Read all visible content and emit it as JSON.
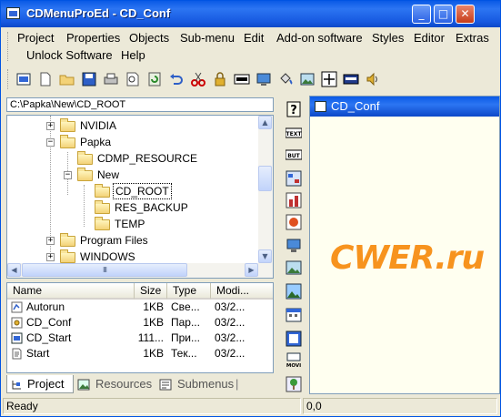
{
  "window": {
    "title": "CDMenuProEd - CD_Conf"
  },
  "caption_buttons": {
    "minimize": "_",
    "maximize": "□",
    "close": "✕"
  },
  "menu": {
    "items": [
      "Project",
      "Properties",
      "Objects",
      "Sub-menu",
      "Edit",
      "Add-on software",
      "Styles",
      "Editor",
      "Extras",
      "Unlock Software",
      "Help"
    ]
  },
  "toolbar": {
    "icons": [
      "new-project-icon",
      "new-file-icon",
      "open-folder-icon",
      "save-icon",
      "print-icon",
      "print-preview-icon",
      "refresh-icon",
      "undo-icon",
      "cut-icon",
      "lock-icon",
      "start-button-icon",
      "monitor-icon",
      "paint-bucket-icon",
      "picture-icon",
      "move-arrows-icon",
      "title-icon",
      "speaker-icon"
    ]
  },
  "path": {
    "value": "C:\\Papka\\New\\CD_ROOT"
  },
  "tree": {
    "nodes": [
      {
        "label": "NVIDIA",
        "expander": "+",
        "level": 0
      },
      {
        "label": "Papka",
        "expander": "−",
        "level": 0
      },
      {
        "label": "CDMP_RESOURCE",
        "expander": "",
        "level": 1
      },
      {
        "label": "New",
        "expander": "−",
        "level": 1
      },
      {
        "label": "CD_ROOT",
        "expander": "",
        "level": 2,
        "selected": true
      },
      {
        "label": "RES_BACKUP",
        "expander": "",
        "level": 2
      },
      {
        "label": "TEMP",
        "expander": "",
        "level": 2
      },
      {
        "label": "Program Files",
        "expander": "+",
        "level": 0
      },
      {
        "label": "WINDOWS",
        "expander": "+",
        "level": 0
      }
    ],
    "hscroll_grip": "III"
  },
  "file_list": {
    "columns": [
      "Name",
      "Size",
      "Type",
      "Modi..."
    ],
    "rows": [
      {
        "name": "Autorun",
        "size": "1KB",
        "type": "Свe...",
        "modified": "03/2...",
        "icon": "autorun-file-icon"
      },
      {
        "name": "CD_Conf",
        "size": "1KB",
        "type": "Пар...",
        "modified": "03/2...",
        "icon": "config-file-icon"
      },
      {
        "name": "CD_Start",
        "size": "111...",
        "type": "При...",
        "modified": "03/2...",
        "icon": "application-icon"
      },
      {
        "name": "Start",
        "size": "1KB",
        "type": "Тек...",
        "modified": "03/2...",
        "icon": "text-file-icon"
      }
    ]
  },
  "tabs": [
    {
      "label": "Project",
      "active": true,
      "icon": "project-tree-icon"
    },
    {
      "label": "Resources",
      "active": false,
      "icon": "resources-icon"
    },
    {
      "label": "Submenus",
      "active": false,
      "icon": "submenus-icon"
    }
  ],
  "object_toolbar": {
    "items": [
      {
        "icon": "help-icon",
        "text": "?"
      },
      {
        "icon": "text-object-icon",
        "text": "TEXT"
      },
      {
        "icon": "button-object-icon",
        "text": "BUT"
      },
      {
        "icon": "menu-object-icon",
        "text": ""
      },
      {
        "icon": "chart-object-icon",
        "text": ""
      },
      {
        "icon": "record-object-icon",
        "text": ""
      },
      {
        "icon": "screen-object-icon",
        "text": ""
      },
      {
        "icon": "image-object-icon",
        "text": ""
      },
      {
        "icon": "photo-object-icon",
        "text": ""
      },
      {
        "icon": "calendar-object-icon",
        "text": ""
      },
      {
        "icon": "film-object-icon",
        "text": ""
      },
      {
        "icon": "movie-object-icon",
        "text": "MOVI"
      },
      {
        "icon": "tree-object-icon",
        "text": ""
      }
    ]
  },
  "document": {
    "title": "CD_Conf",
    "watermark": "CWER.ru"
  },
  "statusbar": {
    "status": "Ready",
    "coords": "0,0"
  },
  "colors": {
    "titlebar": "#0a5ae6",
    "watermark": "#f7931e",
    "canvas": "#fffff0",
    "chrome": "#ece9d8"
  }
}
